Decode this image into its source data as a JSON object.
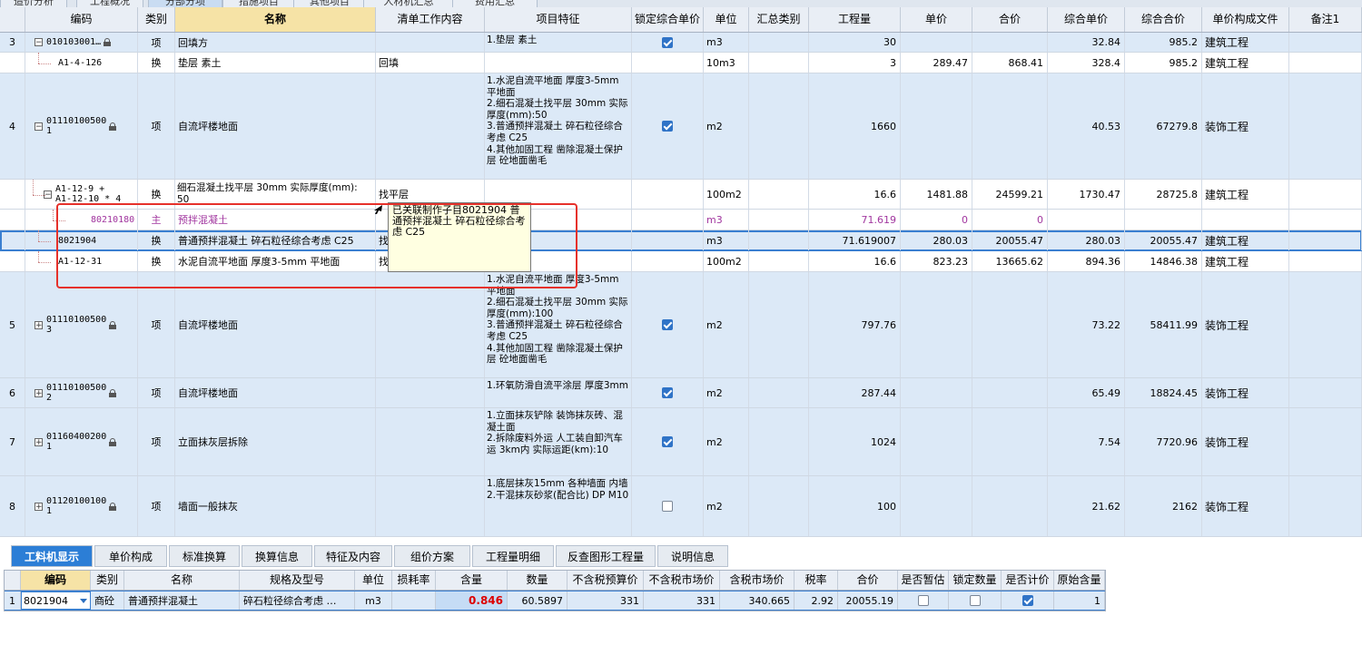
{
  "top_tabs": [
    {
      "label": "造价分析",
      "active": false
    },
    {
      "label": "工程概况",
      "active": false
    },
    {
      "label": "分部分项",
      "active": true
    },
    {
      "label": "措施项目",
      "active": false
    },
    {
      "label": "其他项目",
      "active": false
    },
    {
      "label": "人材机汇总",
      "active": false
    },
    {
      "label": "费用汇总",
      "active": false
    }
  ],
  "columns": [
    "",
    "编码",
    "类别",
    "名称",
    "清单工作内容",
    "项目特征",
    "锁定综合单价",
    "单位",
    "汇总类别",
    "工程量",
    "单价",
    "合价",
    "综合单价",
    "综合合价",
    "单价构成文件",
    "备注1"
  ],
  "rows": [
    {
      "no": "3",
      "code": "010103001…",
      "expand": "−",
      "lock": true,
      "type": "项",
      "name": "回填方",
      "work": "",
      "feature": "1.垫层 素土",
      "locked": true,
      "unit": "m3",
      "qty": "30",
      "price": "",
      "total": "",
      "uprice": "32.84",
      "utotal": "985.2",
      "file": "建筑工程"
    },
    {
      "no": "",
      "code": "A1-4-126",
      "type": "换",
      "name": "垫层 素土",
      "work": "回填",
      "feature": "",
      "unit": "10m3",
      "qty": "3",
      "price": "289.47",
      "total": "868.41",
      "uprice": "328.4",
      "utotal": "985.2",
      "file": "建筑工程"
    },
    {
      "no": "4",
      "code": "01110100500\n1",
      "expand": "−",
      "lock": true,
      "type": "项",
      "name": "自流坪楼地面",
      "work": "",
      "feature": "1.水泥自流平地面 厚度3-5mm 平地面\n2.细石混凝土找平层 30mm 实际厚度(mm):50\n3.普通预拌混凝土 碎石粒径综合考虑 C25\n4.其他加固工程 凿除混凝土保护层 砼地面凿毛",
      "locked": true,
      "unit": "m2",
      "qty": "1660",
      "price": "",
      "total": "",
      "uprice": "40.53",
      "utotal": "67279.8",
      "file": "装饰工程"
    },
    {
      "no": "",
      "code": "A1-12-9 +\nA1-12-10 * 4",
      "expand": "−",
      "type": "换",
      "name": "细石混凝土找平层 30mm 实际厚度(mm):\n50",
      "work": "找平层",
      "feature": "",
      "unit": "100m2",
      "qty": "16.6",
      "price": "1481.88",
      "total": "24599.21",
      "uprice": "1730.47",
      "utotal": "28725.8",
      "file": "建筑工程"
    },
    {
      "no": "",
      "code": "80210180",
      "type": "主",
      "name": "预拌混凝土",
      "work": "",
      "feature": "",
      "unit": "m3",
      "qty": "71.619",
      "price": "0",
      "total": "0",
      "uprice": "",
      "utotal": "",
      "file": "",
      "purple": true
    },
    {
      "no": "",
      "code": "8021904",
      "type": "换",
      "name": "普通预拌混凝土 碎石粒径综合考虑 C25",
      "work": "找",
      "feature": "",
      "unit": "m3",
      "qty": "71.619007",
      "price": "280.03",
      "total": "20055.47",
      "uprice": "280.03",
      "utotal": "20055.47",
      "file": "建筑工程",
      "selected": true
    },
    {
      "no": "",
      "code": "A1-12-31",
      "type": "换",
      "name": "水泥自流平地面 厚度3-5mm 平地面",
      "work": "找",
      "feature": "",
      "unit": "100m2",
      "qty": "16.6",
      "price": "823.23",
      "total": "13665.62",
      "uprice": "894.36",
      "utotal": "14846.38",
      "file": "建筑工程"
    },
    {
      "no": "5",
      "code": "01110100500\n3",
      "expand": "+",
      "lock": true,
      "type": "项",
      "name": "自流坪楼地面",
      "work": "",
      "feature": "1.水泥自流平地面 厚度3-5mm 平地面\n2.细石混凝土找平层 30mm 实际厚度(mm):100\n3.普通预拌混凝土 碎石粒径综合考虑 C25\n4.其他加固工程 凿除混凝土保护层 砼地面凿毛",
      "locked": true,
      "unit": "m2",
      "qty": "797.76",
      "price": "",
      "total": "",
      "uprice": "73.22",
      "utotal": "58411.99",
      "file": "装饰工程"
    },
    {
      "no": "6",
      "code": "01110100500\n2",
      "expand": "+",
      "lock": true,
      "type": "项",
      "name": "自流坪楼地面",
      "work": "",
      "feature": "1.环氧防滑自流平涂层 厚度3mm",
      "locked": true,
      "unit": "m2",
      "qty": "287.44",
      "price": "",
      "total": "",
      "uprice": "65.49",
      "utotal": "18824.45",
      "file": "装饰工程"
    },
    {
      "no": "7",
      "code": "01160400200\n1",
      "expand": "+",
      "lock": true,
      "type": "项",
      "name": "立面抹灰层拆除",
      "work": "",
      "feature": "1.立面抹灰铲除 装饰抹灰砖、混凝土面\n2.拆除废料外运 人工装自卸汽车运 3km内 实际运距(km):10",
      "locked": true,
      "unit": "m2",
      "qty": "1024",
      "price": "",
      "total": "",
      "uprice": "7.54",
      "utotal": "7720.96",
      "file": "装饰工程"
    },
    {
      "no": "8",
      "code": "01120100100\n1",
      "expand": "+",
      "lock": true,
      "type": "项",
      "name": "墙面一般抹灰",
      "work": "",
      "feature": "1.底层抹灰15mm 各种墙面 内墙\n2.干混抹灰砂浆(配合比) DP M10",
      "locked": false,
      "unit": "m2",
      "qty": "100",
      "price": "",
      "total": "",
      "uprice": "21.62",
      "utotal": "2162",
      "file": "装饰工程"
    }
  ],
  "tooltip": "已关联制作子目8021904 普通预拌混凝土 碎石粒径综合考虑 C25",
  "bottom_tabs": [
    {
      "label": "工料机显示",
      "active": true
    },
    {
      "label": "单价构成",
      "active": false
    },
    {
      "label": "标准换算",
      "active": false
    },
    {
      "label": "换算信息",
      "active": false
    },
    {
      "label": "特征及内容",
      "active": false
    },
    {
      "label": "组价方案",
      "active": false
    },
    {
      "label": "工程量明细",
      "active": false
    },
    {
      "label": "反查图形工程量",
      "active": false
    },
    {
      "label": "说明信息",
      "active": false
    }
  ],
  "bottom_columns": [
    "",
    "编码",
    "类别",
    "名称",
    "规格及型号",
    "单位",
    "损耗率",
    "含量",
    "数量",
    "不含税预算价",
    "不含税市场价",
    "含税市场价",
    "税率",
    "合价",
    "是否暂估",
    "锁定数量",
    "是否计价",
    "原始含量"
  ],
  "bottom_row": {
    "no": "1",
    "code": "8021904",
    "type": "商砼",
    "name": "普通预拌混凝土",
    "spec": "碎石粒径综合考虑 …",
    "unit": "m3",
    "loss": "",
    "content": "0.846",
    "qty": "60.5897",
    "budget": "331",
    "market": "331",
    "taxmarket": "340.665",
    "tax": "2.92",
    "total": "20055.19",
    "estimate": false,
    "lockqty": false,
    "priced": true,
    "origin": "1"
  },
  "colors": {
    "accent": "#2c7ed6",
    "highlight_box": "#e6312b",
    "purple_text": "#a1369f",
    "header_selected": "#f6e3a6"
  }
}
